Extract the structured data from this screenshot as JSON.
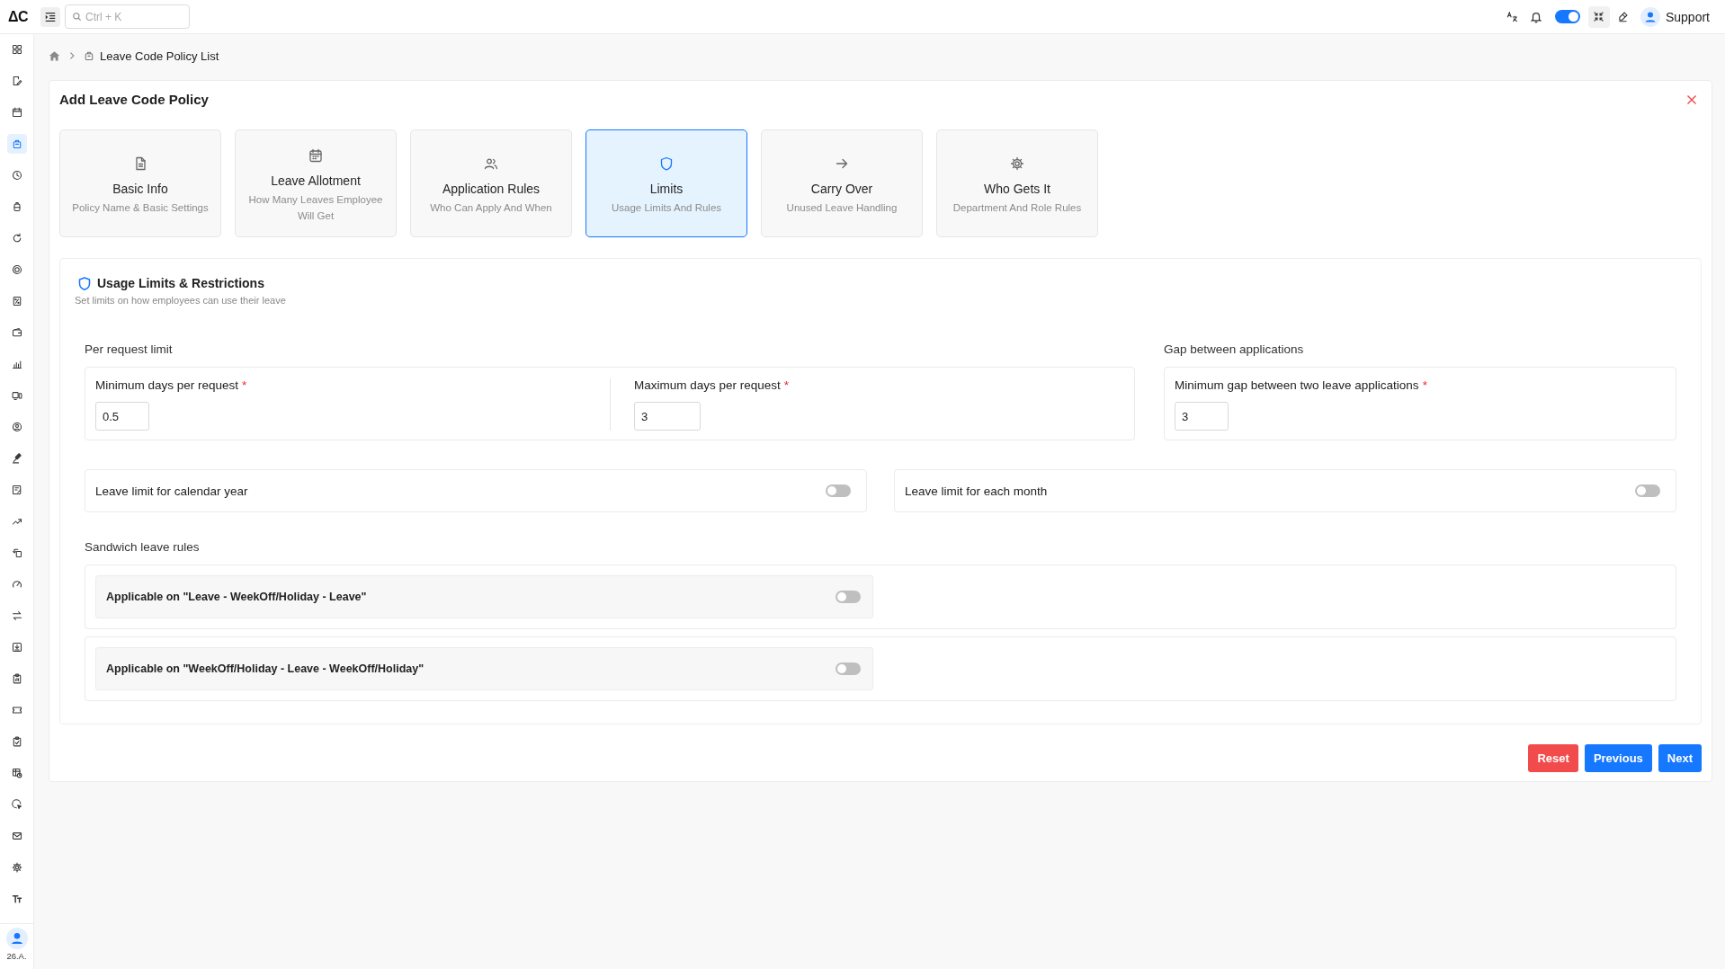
{
  "header": {
    "logo": "ΔC",
    "search": {
      "placeholder": "Ctrl + K"
    },
    "theme_toggle": {
      "on": true
    },
    "user": {
      "name": "Support"
    }
  },
  "sidebar": {
    "items": [
      {
        "selected": false
      },
      {
        "selected": false
      },
      {
        "selected": false
      },
      {
        "selected": true
      },
      {
        "selected": false
      },
      {
        "selected": false
      },
      {
        "selected": false
      },
      {
        "selected": false
      },
      {
        "selected": false
      },
      {
        "selected": false
      },
      {
        "selected": false
      },
      {
        "selected": false
      },
      {
        "selected": false
      },
      {
        "selected": false
      },
      {
        "selected": false
      },
      {
        "selected": false
      },
      {
        "selected": false
      },
      {
        "selected": false
      },
      {
        "selected": false
      },
      {
        "selected": false
      },
      {
        "selected": false
      },
      {
        "selected": false
      },
      {
        "selected": false
      },
      {
        "selected": false
      },
      {
        "selected": false
      },
      {
        "selected": false
      },
      {
        "selected": false
      },
      {
        "selected": false
      }
    ],
    "user": {
      "label": "26.A."
    }
  },
  "breadcrumb": {
    "current": "Leave Code Policy List"
  },
  "form": {
    "title": "Add Leave Code Policy",
    "steps": [
      {
        "title": "Basic Info",
        "subtitle": "Policy Name & Basic Settings",
        "selected": false
      },
      {
        "title": "Leave Allotment",
        "subtitle": "How Many Leaves Employee Will Get",
        "selected": false
      },
      {
        "title": "Application Rules",
        "subtitle": "Who Can Apply And When",
        "selected": false
      },
      {
        "title": "Limits",
        "subtitle": "Usage Limits And Rules",
        "selected": true
      },
      {
        "title": "Carry Over",
        "subtitle": "Unused Leave Handling",
        "selected": false
      },
      {
        "title": "Who Gets It",
        "subtitle": "Department And Role Rules",
        "selected": false
      }
    ],
    "section": {
      "title": "Usage Limits & Restrictions",
      "subtitle": "Set limits on how employees can use their leave",
      "per_request_limit": {
        "label": "Per request limit",
        "fields": [
          {
            "label": "Minimum days per request",
            "required_mark": "*",
            "value": "0.5"
          },
          {
            "label": "Maximum days per request",
            "required_mark": "*",
            "value": "3"
          }
        ]
      },
      "gap_between_applications": {
        "label": "Gap between applications",
        "fields": [
          {
            "label": "Minimum gap between two leave applications",
            "required_mark": "*",
            "value": "3"
          }
        ]
      },
      "limit_toggles": [
        {
          "label": "Leave limit for calendar year",
          "on": false
        },
        {
          "label": "Leave limit for each month",
          "on": false
        }
      ],
      "sandwich_rules": {
        "label": "Sandwich leave rules",
        "rules": [
          {
            "label": "Applicable on \"Leave - WeekOff/Holiday - Leave\"",
            "on": false
          },
          {
            "label": "Applicable on \"WeekOff/Holiday - Leave - WeekOff/Holiday\"",
            "on": false
          }
        ]
      }
    },
    "buttons": [
      {
        "label": "Reset",
        "kind": "danger"
      },
      {
        "label": "Previous",
        "kind": "primary"
      },
      {
        "label": "Next",
        "kind": "primary"
      }
    ]
  }
}
